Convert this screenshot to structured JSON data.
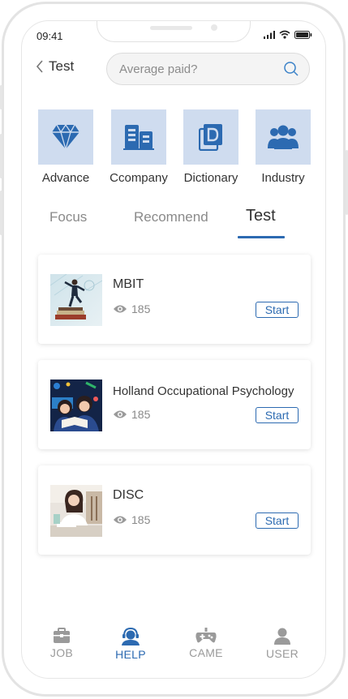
{
  "status_bar": {
    "time": "09:41"
  },
  "header": {
    "back_label": "Test",
    "search_placeholder": "Average paid?"
  },
  "categories": [
    {
      "label": "Advance",
      "icon": "diamond-icon"
    },
    {
      "label": "Ccompany",
      "icon": "building-icon"
    },
    {
      "label": "Dictionary",
      "icon": "dictionary-icon"
    },
    {
      "label": "Industry",
      "icon": "group-icon"
    }
  ],
  "tabs": [
    {
      "label": "Focus"
    },
    {
      "label": "Recomnend"
    },
    {
      "label": "Test",
      "active": true
    }
  ],
  "tests": [
    {
      "title": "MBIT",
      "views": "185",
      "action": "Start",
      "thumbnail": "businessman-on-books"
    },
    {
      "title": "Holland Occupational Psychology",
      "views": "185",
      "action": "Start",
      "thumbnail": "students-reading"
    },
    {
      "title": "DISC",
      "views": "185",
      "action": "Start",
      "thumbnail": "woman-at-desk"
    }
  ],
  "bottom_nav": [
    {
      "label": "JOB",
      "icon": "briefcase-icon"
    },
    {
      "label": "HELP",
      "icon": "helper-icon",
      "active": true
    },
    {
      "label": "CAME",
      "icon": "gamepad-icon"
    },
    {
      "label": "USER",
      "icon": "user-icon"
    }
  ],
  "colors": {
    "accent": "#2c6ab1",
    "icon_tile_bg": "#cfdcef",
    "text": "#333333",
    "muted": "#8a8a8a",
    "inactive_nav": "#9a9a9a"
  }
}
